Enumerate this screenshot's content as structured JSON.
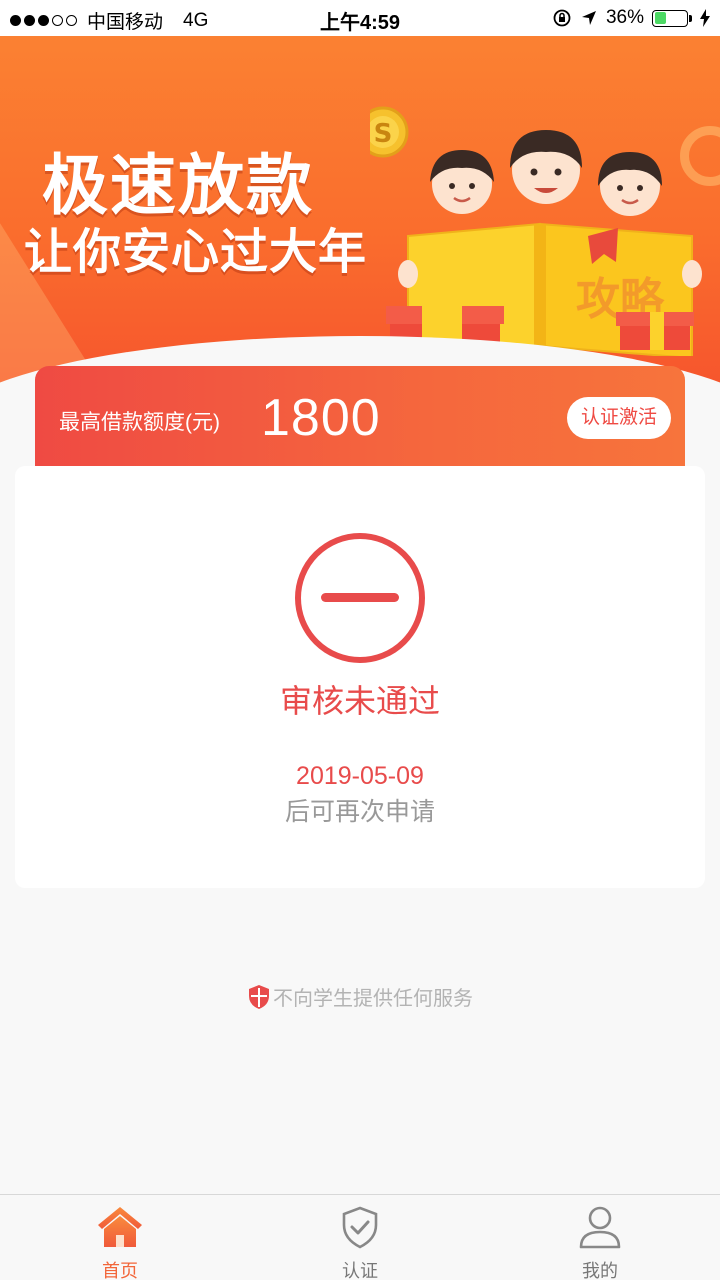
{
  "status_bar": {
    "carrier": "中国移动",
    "network": "4G",
    "time": "上午4:59",
    "battery_percent": "36%",
    "battery_level": 0.36,
    "icons": [
      "signal-dots-icon",
      "orientation-lock-icon",
      "location-arrow-icon",
      "battery-icon",
      "charging-bolt-icon"
    ]
  },
  "banner": {
    "title": "极速放款",
    "subtitle": "让你安心过大年",
    "book_label": "攻略",
    "coin_symbol": "S"
  },
  "limit": {
    "label": "最高借款额度(元)",
    "amount": "1800",
    "button_label": "认证激活"
  },
  "review": {
    "status": "审核未通过",
    "retry_date": "2019-05-09",
    "retry_note": "后可再次申请"
  },
  "notice": {
    "text": "不向学生提供任何服务",
    "icon": "shield-icon"
  },
  "tabs": [
    {
      "label": "首页",
      "icon": "home-icon",
      "active": true
    },
    {
      "label": "认证",
      "icon": "shield-check-icon",
      "active": false
    },
    {
      "label": "我的",
      "icon": "user-icon",
      "active": false
    }
  ],
  "colors": {
    "brand_orange": "#fa6d2d",
    "brand_red": "#ef4a43",
    "status_red": "#e84b4b",
    "tab_active": "#f2663a",
    "muted_text": "#999999"
  }
}
